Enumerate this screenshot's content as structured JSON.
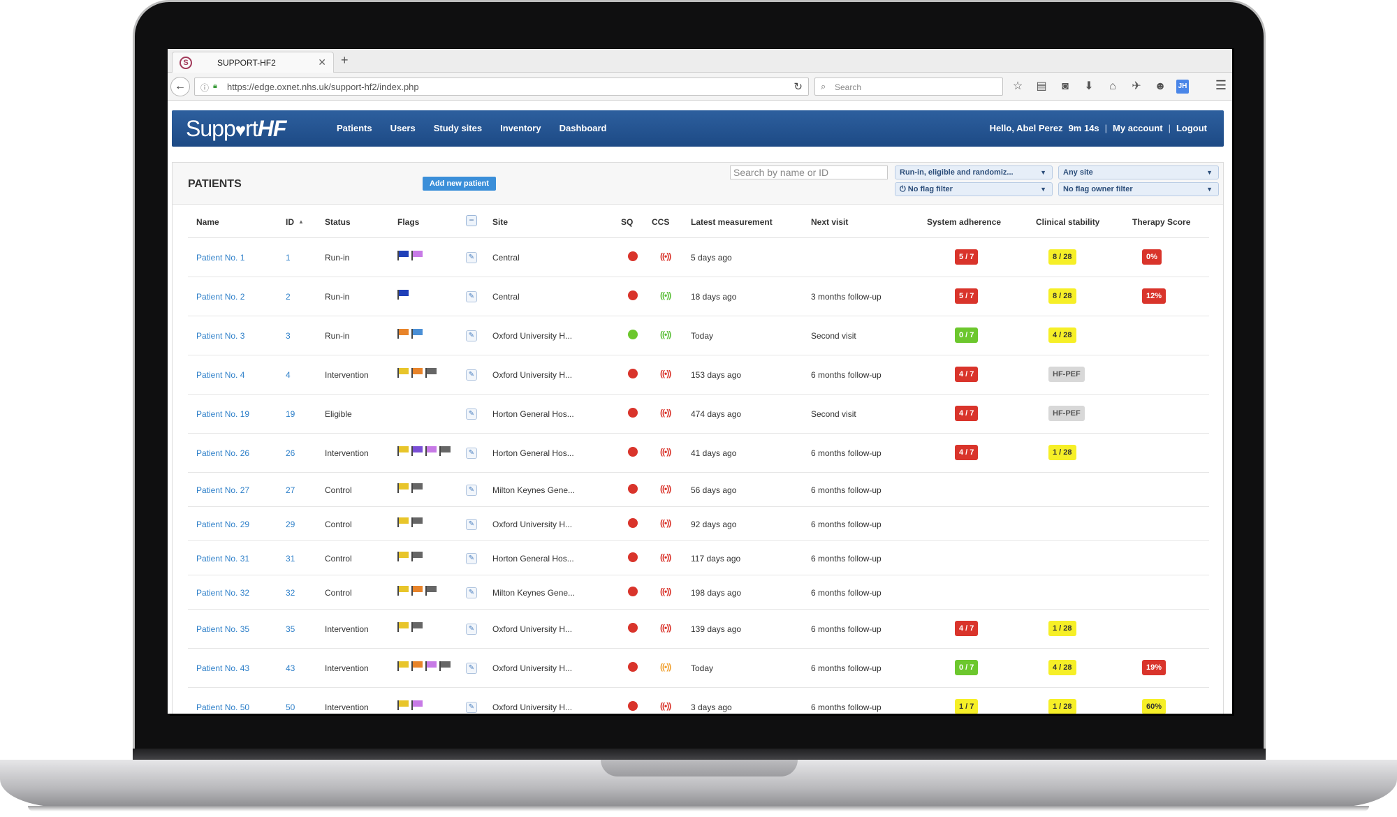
{
  "browser": {
    "tab_title": "SUPPORT-HF2",
    "url": "https://edge.oxnet.nhs.uk/support-hf2/index.php",
    "search_placeholder": "Search"
  },
  "app": {
    "logo_text_a": "Supp",
    "logo_text_b": "rt",
    "logo_text_c": "HF",
    "nav": [
      "Patients",
      "Users",
      "Study sites",
      "Inventory",
      "Dashboard"
    ],
    "greeting": "Hello, Abel Perez",
    "timer": "9m 14s",
    "my_account": "My account",
    "logout": "Logout"
  },
  "panel": {
    "title": "PATIENTS",
    "add_button": "Add new patient",
    "search_placeholder": "Search by name or ID",
    "filter_status": "Run-in, eligible and randomiz...",
    "filter_site": "Any site",
    "filter_flag": "No flag filter",
    "filter_flag_owner": "No flag owner filter"
  },
  "columns": {
    "name": "Name",
    "id": "ID",
    "status": "Status",
    "flags": "Flags",
    "site": "Site",
    "sq": "SQ",
    "ccs": "CCS",
    "latest": "Latest measurement",
    "next": "Next visit",
    "adherence": "System adherence",
    "stability": "Clinical stability",
    "therapy": "Therapy Score"
  },
  "colors": {
    "flag_navy": "#1f3fb8",
    "flag_purple": "#c77ae6",
    "flag_orange": "#e8842a",
    "flag_blue": "#4a8fd6",
    "flag_yellow": "#e8c52a",
    "flag_grey": "#666666",
    "flag_violet": "#7a4fd6",
    "dot_red": "#d9342b",
    "dot_green": "#6cc72d",
    "signal_red": "#d9342b",
    "signal_green": "#5cbf3a",
    "signal_orange": "#f0a030"
  },
  "rows": [
    {
      "name": "Patient No. 1",
      "id": "1",
      "status": "Run-in",
      "flags": [
        "flag_navy",
        "flag_purple"
      ],
      "site": "Central",
      "sq": "dot_red",
      "ccs": "signal_red",
      "latest": "5 days ago",
      "next": "",
      "adherence": {
        "text": "5 / 7",
        "color": "red"
      },
      "stability": {
        "text": "8 / 28",
        "color": "yellow"
      },
      "therapy": {
        "text": "0%",
        "color": "red"
      }
    },
    {
      "name": "Patient No. 2",
      "id": "2",
      "status": "Run-in",
      "flags": [
        "flag_navy"
      ],
      "site": "Central",
      "sq": "dot_red",
      "ccs": "signal_green",
      "latest": "18 days ago",
      "next": "3 months follow-up",
      "adherence": {
        "text": "5 / 7",
        "color": "red"
      },
      "stability": {
        "text": "8 / 28",
        "color": "yellow"
      },
      "therapy": {
        "text": "12%",
        "color": "red"
      }
    },
    {
      "name": "Patient No. 3",
      "id": "3",
      "status": "Run-in",
      "flags": [
        "flag_orange",
        "flag_blue"
      ],
      "site": "Oxford University H...",
      "sq": "dot_green",
      "ccs": "signal_green",
      "latest": "Today",
      "next": "Second visit",
      "adherence": {
        "text": "0 / 7",
        "color": "green"
      },
      "stability": {
        "text": "4 / 28",
        "color": "yellow"
      },
      "therapy": null
    },
    {
      "name": "Patient No. 4",
      "id": "4",
      "status": "Intervention",
      "flags": [
        "flag_yellow",
        "flag_orange",
        "flag_grey"
      ],
      "site": "Oxford University H...",
      "sq": "dot_red",
      "ccs": "signal_red",
      "latest": "153 days ago",
      "next": "6 months follow-up",
      "adherence": {
        "text": "4 / 7",
        "color": "red"
      },
      "stability": {
        "text": "HF-PEF",
        "color": "grey"
      },
      "therapy": null
    },
    {
      "name": "Patient No. 19",
      "id": "19",
      "status": "Eligible",
      "flags": [],
      "site": "Horton General Hos...",
      "sq": "dot_red",
      "ccs": "signal_red",
      "latest": "474 days ago",
      "next": "Second visit",
      "adherence": {
        "text": "4 / 7",
        "color": "red"
      },
      "stability": {
        "text": "HF-PEF",
        "color": "grey"
      },
      "therapy": null
    },
    {
      "name": "Patient No. 26",
      "id": "26",
      "status": "Intervention",
      "flags": [
        "flag_yellow",
        "flag_violet",
        "flag_purple",
        "flag_grey"
      ],
      "site": "Horton General Hos...",
      "sq": "dot_red",
      "ccs": "signal_red",
      "latest": "41 days ago",
      "next": "6 months follow-up",
      "adherence": {
        "text": "4 / 7",
        "color": "red"
      },
      "stability": {
        "text": "1 / 28",
        "color": "yellow"
      },
      "therapy": null
    },
    {
      "name": "Patient No. 27",
      "id": "27",
      "status": "Control",
      "flags": [
        "flag_yellow",
        "flag_grey"
      ],
      "site": "Milton Keynes Gene...",
      "sq": "dot_red",
      "ccs": "signal_red",
      "latest": "56 days ago",
      "next": "6 months follow-up",
      "adherence": null,
      "stability": null,
      "therapy": null
    },
    {
      "name": "Patient No. 29",
      "id": "29",
      "status": "Control",
      "flags": [
        "flag_yellow",
        "flag_grey"
      ],
      "site": "Oxford University H...",
      "sq": "dot_red",
      "ccs": "signal_red",
      "latest": "92 days ago",
      "next": "6 months follow-up",
      "adherence": null,
      "stability": null,
      "therapy": null
    },
    {
      "name": "Patient No. 31",
      "id": "31",
      "status": "Control",
      "flags": [
        "flag_yellow",
        "flag_grey"
      ],
      "site": "Horton General Hos...",
      "sq": "dot_red",
      "ccs": "signal_red",
      "latest": "117 days ago",
      "next": "6 months follow-up",
      "adherence": null,
      "stability": null,
      "therapy": null
    },
    {
      "name": "Patient No. 32",
      "id": "32",
      "status": "Control",
      "flags": [
        "flag_yellow",
        "flag_orange",
        "flag_grey"
      ],
      "site": "Milton Keynes Gene...",
      "sq": "dot_red",
      "ccs": "signal_red",
      "latest": "198 days ago",
      "next": "6 months follow-up",
      "adherence": null,
      "stability": null,
      "therapy": null
    },
    {
      "name": "Patient No. 35",
      "id": "35",
      "status": "Intervention",
      "flags": [
        "flag_yellow",
        "flag_grey"
      ],
      "site": "Oxford University H...",
      "sq": "dot_red",
      "ccs": "signal_red",
      "latest": "139 days ago",
      "next": "6 months follow-up",
      "adherence": {
        "text": "4 / 7",
        "color": "red"
      },
      "stability": {
        "text": "1 / 28",
        "color": "yellow"
      },
      "therapy": null
    },
    {
      "name": "Patient No. 43",
      "id": "43",
      "status": "Intervention",
      "flags": [
        "flag_yellow",
        "flag_orange",
        "flag_purple",
        "flag_grey"
      ],
      "site": "Oxford University H...",
      "sq": "dot_red",
      "ccs": "signal_orange",
      "latest": "Today",
      "next": "6 months follow-up",
      "adherence": {
        "text": "0 / 7",
        "color": "green"
      },
      "stability": {
        "text": "4 / 28",
        "color": "yellow"
      },
      "therapy": {
        "text": "19%",
        "color": "red"
      }
    },
    {
      "name": "Patient No. 50",
      "id": "50",
      "status": "Intervention",
      "flags": [
        "flag_yellow",
        "flag_purple"
      ],
      "site": "Oxford University H...",
      "sq": "dot_red",
      "ccs": "signal_red",
      "latest": "3 days ago",
      "next": "6 months follow-up",
      "adherence": {
        "text": "1 / 7",
        "color": "yellow"
      },
      "stability": {
        "text": "1 / 28",
        "color": "yellow"
      },
      "therapy": {
        "text": "60%",
        "color": "yellow"
      }
    }
  ]
}
